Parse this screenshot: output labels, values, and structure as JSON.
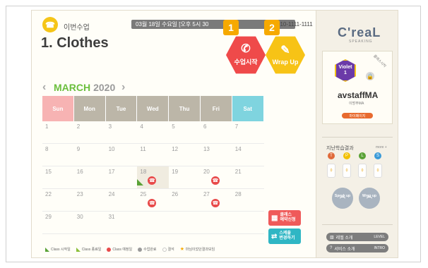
{
  "header": {
    "section_label": "이번수업",
    "lesson_title": "1. Clothes",
    "date_text": "03월 18일 수요일 [오후 5시 30",
    "phone_partial": "010-1111-1111"
  },
  "badges": [
    "1",
    "2"
  ],
  "actions": {
    "start_class": "수업시작",
    "wrap_up": "Wrap Up",
    "start_color": "#ef4a4a",
    "wrap_color": "#f7c316"
  },
  "calendar": {
    "month": "MARCH",
    "year": "2020",
    "weekdays": [
      "Sun",
      "Mon",
      "Tue",
      "Wed",
      "Thu",
      "Fri",
      "Sat"
    ],
    "weeks": [
      [
        "1",
        "2",
        "3",
        "4",
        "5",
        "6",
        "7"
      ],
      [
        "8",
        "9",
        "10",
        "11",
        "12",
        "13",
        "14"
      ],
      [
        "15",
        "16",
        "17",
        "18",
        "19",
        "20",
        "21"
      ],
      [
        "22",
        "23",
        "24",
        "25",
        "26",
        "27",
        "28"
      ],
      [
        "29",
        "30",
        "31",
        "",
        "",
        "",
        ""
      ]
    ],
    "colors": {
      "sun": "#f7b3b3",
      "sat": "#7fd4df",
      "weekday": "#bcb6a8",
      "accent": "#6bbf3d"
    }
  },
  "side_actions": {
    "class_request": "클래스\n예약신청",
    "schedule_change": "스케줄\n변경하기"
  },
  "legend": [
    {
      "label": "Class 시작일",
      "color": "#5aa236"
    },
    {
      "label": "Class 종료일",
      "color": "#8cbf3a"
    },
    {
      "label": "Class 예정일",
      "color": "#e84a4a"
    },
    {
      "label": "수업완료",
      "color": "#9a9a9a"
    },
    {
      "label": "결석",
      "color": "#c8c8c8"
    },
    {
      "label": "마님이었던결과보임",
      "color": "#f6a900"
    }
  ],
  "sidebar": {
    "logo": "C'reaL",
    "logo_sub": "SPEAKING",
    "ribbon": "클래스시작",
    "level_name": "Violet",
    "level_num": "1",
    "username": "avstaffMA",
    "user_sub": "이방주MA",
    "mypage": "마이페이지",
    "recent_results": "지난학습결과",
    "more": "more +",
    "result_icons": [
      {
        "glyph": "T",
        "color": "#e06a3a"
      },
      {
        "glyph": "P",
        "color": "#f2c000"
      },
      {
        "glyph": "L",
        "color": "#5aa236"
      },
      {
        "glyph": "S",
        "color": "#3a9ad8"
      }
    ],
    "meter_values": [
      "0",
      "0",
      "0",
      "0"
    ],
    "speak_up": "Speak up",
    "wrap_up": "Wrap up",
    "level_intro": "레벨 소개",
    "level_intro_en": "LEVEL",
    "service_intro": "서비스 소개",
    "service_intro_en": "INTRO"
  }
}
